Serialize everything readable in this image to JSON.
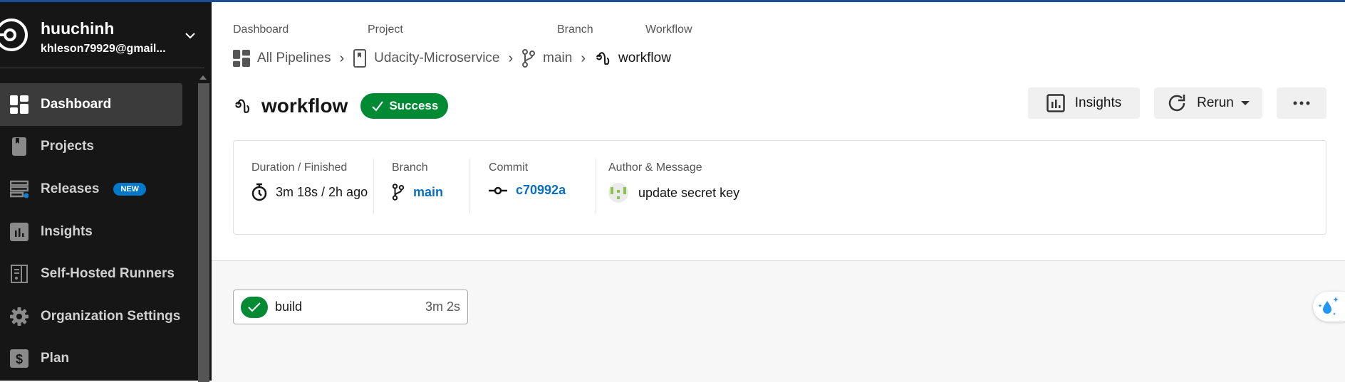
{
  "colors": {
    "accent": "#1a4f9c",
    "success": "#008a33",
    "link": "#0a6fc2",
    "new_badge": "#0078ca"
  },
  "org": {
    "name": "huuchinh",
    "email": "khleson79929@gmail..."
  },
  "sidebar": {
    "items": [
      {
        "label": "Dashboard",
        "icon": "dashboard-icon",
        "active": true
      },
      {
        "label": "Projects",
        "icon": "book-icon"
      },
      {
        "label": "Releases",
        "icon": "releases-icon",
        "badge": "NEW"
      },
      {
        "label": "Insights",
        "icon": "bar-chart-icon"
      },
      {
        "label": "Self-Hosted Runners",
        "icon": "runner-icon"
      },
      {
        "label": "Organization Settings",
        "icon": "gear-icon"
      },
      {
        "label": "Plan",
        "icon": "dollar-icon"
      }
    ]
  },
  "breadcrumb": {
    "labels": [
      "Dashboard",
      "Project",
      "Branch",
      "Workflow"
    ],
    "items": [
      "All Pipelines",
      "Udacity-Microservice",
      "main",
      "workflow"
    ]
  },
  "header": {
    "title": "workflow",
    "status": "Success",
    "insights_label": "Insights",
    "rerun_label": "Rerun"
  },
  "summary": {
    "duration_label": "Duration / Finished",
    "duration_value": "3m 18s / 2h ago",
    "branch_label": "Branch",
    "branch_value": "main",
    "commit_label": "Commit",
    "commit_value": "c70992a",
    "author_label": "Author & Message",
    "message": "update secret key"
  },
  "jobs": [
    {
      "name": "build",
      "duration": "3m 2s",
      "status": "success"
    }
  ]
}
